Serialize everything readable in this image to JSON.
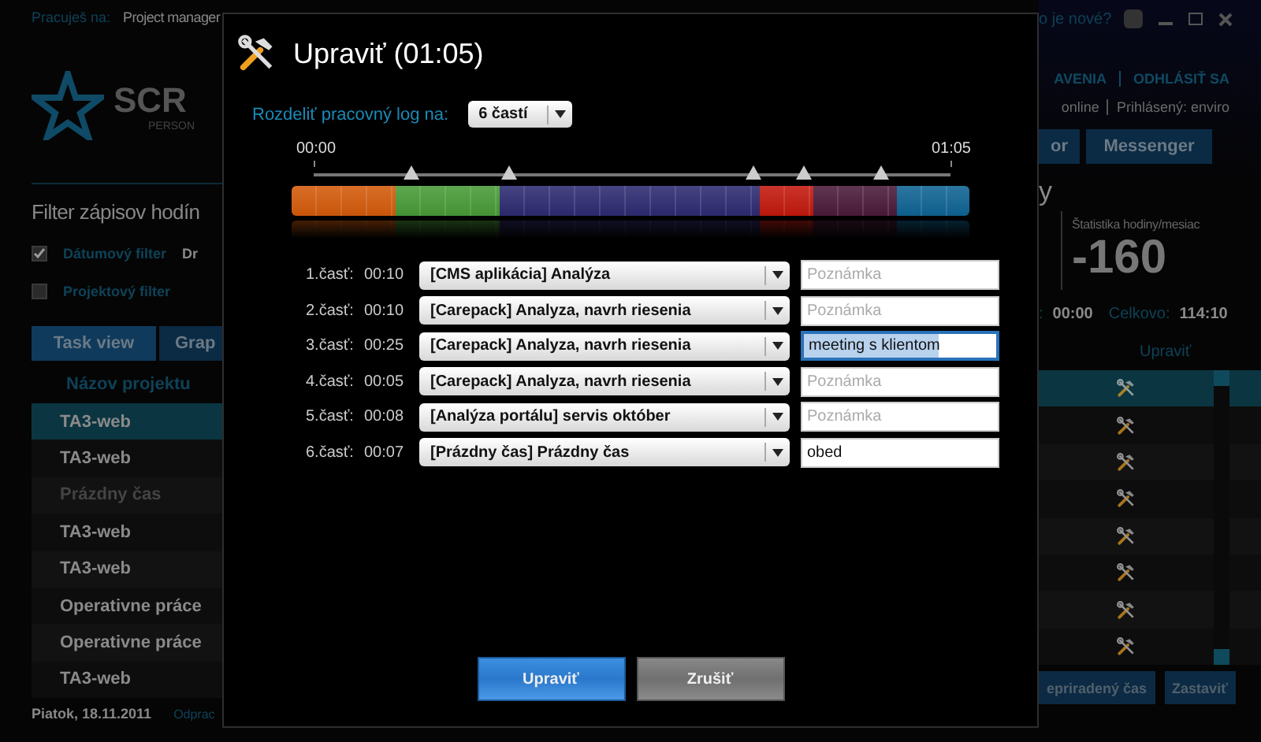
{
  "app": {
    "header": {
      "working_on_label": "Pracuješ na:",
      "working_on_value": "Project manager",
      "whats_new": "o je nové?"
    },
    "logo": {
      "text": "SCR",
      "subtitle": "PERSON"
    },
    "links": [
      {
        "label": "AVENIA"
      },
      {
        "label": "ODHLÁSIŤ SA"
      }
    ],
    "status": [
      {
        "label": "online"
      },
      {
        "label": "Prihlásený: enviro"
      }
    ],
    "nav_tabs": [
      {
        "label": "or",
        "selected": false
      },
      {
        "label": "Messenger",
        "selected": false
      }
    ],
    "page_title": "Filter zápisov hodín",
    "page_title_end": "y",
    "filters": [
      {
        "label": "Dátumový filter",
        "checked": true,
        "extra": "Dr"
      },
      {
        "label": "Projektový filter",
        "checked": false
      }
    ],
    "stat": {
      "label": "Štatistika hodiny/mesiac",
      "value": "-160"
    },
    "totals": [
      {
        "label": ":",
        "value": "00:00"
      },
      {
        "label": "Celkovo:",
        "value": "114:10"
      }
    ],
    "view_tabs": [
      {
        "label": "Task view",
        "selected": true
      },
      {
        "label": "Grap",
        "selected": false
      }
    ],
    "table": {
      "columns": [
        "Názov projektu",
        "Upraviť"
      ],
      "rows": [
        {
          "project": "TA3-web",
          "selected": true,
          "dimmed": false
        },
        {
          "project": "TA3-web",
          "selected": false,
          "dimmed": false
        },
        {
          "project": "Prázdny čas",
          "selected": false,
          "dimmed": true
        },
        {
          "project": "TA3-web",
          "selected": false,
          "dimmed": false
        },
        {
          "project": "TA3-web",
          "selected": false,
          "dimmed": false
        },
        {
          "project": "Operativne práce",
          "selected": false,
          "dimmed": false
        },
        {
          "project": "Operativne práce",
          "selected": false,
          "dimmed": false
        },
        {
          "project": "TA3-web",
          "selected": false,
          "dimmed": false
        }
      ]
    },
    "footer": {
      "date": "Piatok, 18.11.2011",
      "link": "Odprac",
      "buttons": [
        "epriradený čas",
        "Zastaviť"
      ]
    }
  },
  "dialog": {
    "title": "Upraviť (01:05)",
    "split_label": "Rozdeliť pracovný log na:",
    "split_value": "6 častí",
    "start": "00:00",
    "end": "01:05",
    "handles": [
      {
        "level": 0.153
      },
      {
        "level": 0.307
      },
      {
        "level": 0.69
      },
      {
        "level": 0.77
      },
      {
        "level": 0.892
      }
    ],
    "parts": [
      {
        "label": "1.časť:",
        "time": "00:10",
        "task": "[CMS aplikácia] Analýza",
        "color": "#d35a0a",
        "note": {
          "placeholder": "Poznámka",
          "focused": false
        }
      },
      {
        "label": "2.časť:",
        "time": "00:10",
        "task": "[Carepack] Analyza, navrh riesenia",
        "color": "#479a36",
        "note": {
          "placeholder": "Poznámka",
          "focused": false
        }
      },
      {
        "label": "3.časť:",
        "time": "00:25",
        "task": "[Carepack] Analyza, navrh riesenia",
        "color": "#2c2a70",
        "note": {
          "value": "meeting s klientom",
          "focused": true
        }
      },
      {
        "label": "4.časť:",
        "time": "00:05",
        "task": "[Carepack] Analyza, navrh riesenia",
        "color": "#c2180c",
        "note": {
          "placeholder": "Poznámka",
          "focused": false
        }
      },
      {
        "label": "5.časť:",
        "time": "00:08",
        "task": "[Analýza portálu] servis október",
        "color": "#4a1a3a",
        "note": {
          "placeholder": "Poznámka",
          "focused": false
        }
      },
      {
        "label": "6.časť:",
        "time": "00:07",
        "task": "[Prázdny čas] Prázdny čas",
        "color": "#0e6393",
        "note": {
          "value": "obed",
          "focused": false
        }
      }
    ],
    "buttons": [
      {
        "label": "Upraviť",
        "kind": "primary"
      },
      {
        "label": "Zrušiť",
        "kind": "secondary"
      }
    ]
  }
}
